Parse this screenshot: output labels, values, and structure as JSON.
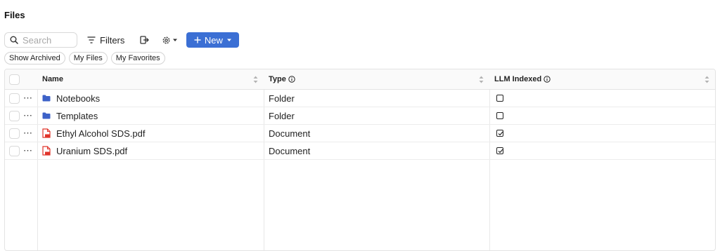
{
  "page": {
    "title": "Files"
  },
  "toolbar": {
    "search_placeholder": "Search",
    "filters_label": "Filters",
    "new_label": "New",
    "icons": [
      "search-icon",
      "filter-icon",
      "exit-icon",
      "gear-icon",
      "chevron-down-icon",
      "plus-icon"
    ]
  },
  "chips": [
    "Show Archived",
    "My Files",
    "My Favorites"
  ],
  "table": {
    "columns": {
      "name": "Name",
      "type": "Type",
      "llm": "LLM Indexed"
    },
    "rows": [
      {
        "name": "Notebooks",
        "type": "Folder",
        "icon": "folder-icon",
        "llm_indexed": false
      },
      {
        "name": "Templates",
        "type": "Folder",
        "icon": "folder-icon",
        "llm_indexed": false
      },
      {
        "name": "Ethyl Alcohol SDS.pdf",
        "type": "Document",
        "icon": "pdf-icon",
        "llm_indexed": true
      },
      {
        "name": "Uranium SDS.pdf",
        "type": "Document",
        "icon": "pdf-icon",
        "llm_indexed": true
      }
    ]
  },
  "colors": {
    "accent": "#3b6fd4",
    "folder": "#3d62c8",
    "pdf": "#e0352b"
  }
}
